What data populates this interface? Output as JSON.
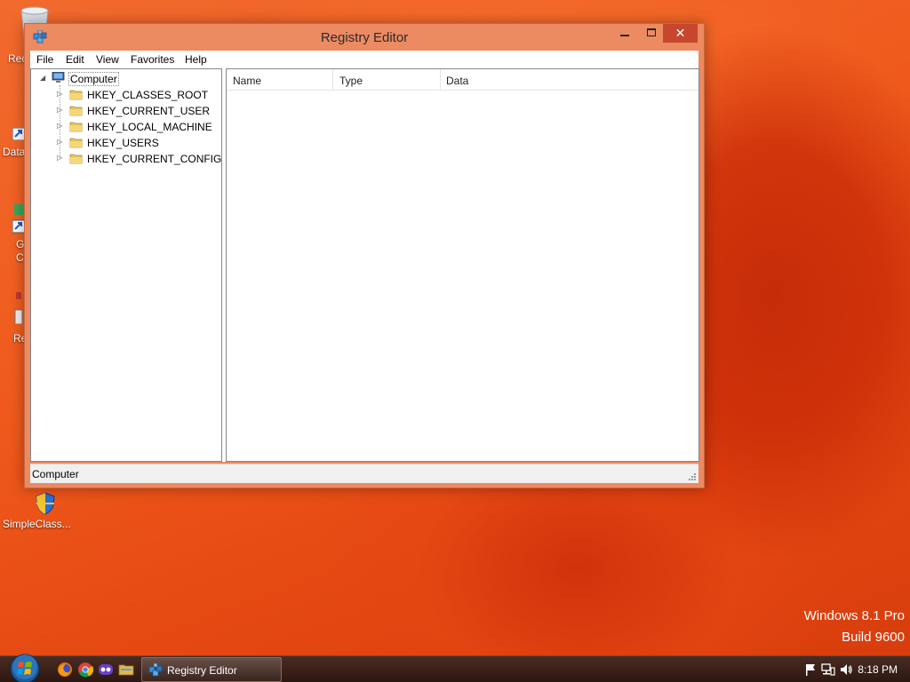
{
  "desktop": {
    "icons": [
      {
        "label": "Rec"
      },
      {
        "label": "Data"
      },
      {
        "label": "G\nC"
      },
      {
        "label": "Re"
      },
      {
        "label": "SimpleClass..."
      }
    ],
    "watermark": {
      "line1": "Windows 8.1 Pro",
      "line2": "Build 9600"
    }
  },
  "window": {
    "title": "Registry Editor",
    "menu": [
      "File",
      "Edit",
      "View",
      "Favorites",
      "Help"
    ],
    "tree": {
      "root": "Computer",
      "children": [
        "HKEY_CLASSES_ROOT",
        "HKEY_CURRENT_USER",
        "HKEY_LOCAL_MACHINE",
        "HKEY_USERS",
        "HKEY_CURRENT_CONFIG"
      ]
    },
    "list": {
      "columns": [
        "Name",
        "Type",
        "Data"
      ]
    },
    "status": "Computer"
  },
  "taskbar": {
    "pinned": [
      "firefox-icon",
      "chrome-icon",
      "app-icon",
      "file-explorer-icon"
    ],
    "open_task": "Registry Editor",
    "clock": "8:18 PM"
  },
  "colors": {
    "wallpaper": "#ef5a1c",
    "window_frame": "#ec8a62",
    "close_button": "#c7472e",
    "taskbar": "#3a2018"
  }
}
